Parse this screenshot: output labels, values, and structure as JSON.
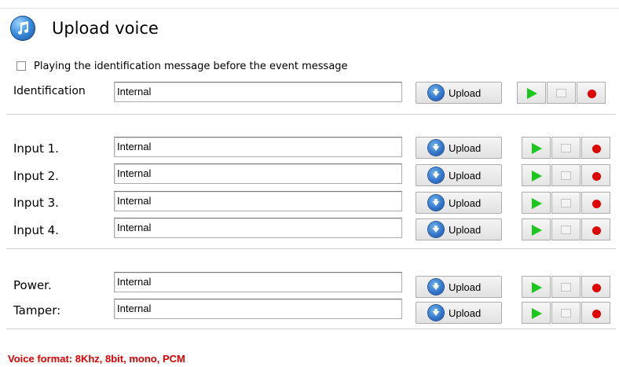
{
  "header": {
    "title": "Upload voice",
    "icon": "music-note-icon"
  },
  "identification_checkbox": {
    "label": "Playing the identification message before the event message",
    "checked": false
  },
  "upload_label": "Upload",
  "rows": [
    {
      "id": "identification",
      "label": "Identification",
      "value": "Internal"
    },
    {
      "id": "input-1",
      "label": "Input 1.",
      "value": "Internal"
    },
    {
      "id": "input-2",
      "label": "Input 2.",
      "value": "Internal"
    },
    {
      "id": "input-3",
      "label": "Input 3.",
      "value": "Internal"
    },
    {
      "id": "input-4",
      "label": "Input 4.",
      "value": "Internal"
    },
    {
      "id": "power",
      "label": "Power.",
      "value": "Internal"
    },
    {
      "id": "tamper",
      "label": "Tamper:",
      "value": "Internal"
    }
  ],
  "footer": {
    "text": "Voice format: 8Khz, 8bit, mono, PCM"
  },
  "colors": {
    "play": "#1cc71c",
    "record": "#e00000",
    "footer_text": "#e00000"
  }
}
